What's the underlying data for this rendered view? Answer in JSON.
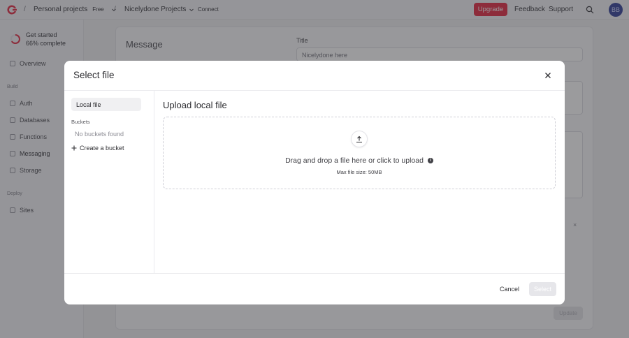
{
  "topbar": {
    "breadcrumb_sep": "/",
    "org": "Personal projects",
    "org_plan": "Free",
    "project": "Nicelydone Projects",
    "connect": "Connect",
    "upgrade": "Upgrade",
    "feedback": "Feedback",
    "support": "Support",
    "avatar_initials": "BB",
    "upgrade_color": "#e5364d"
  },
  "sidebar": {
    "progress_title": "Get started",
    "progress_sub": "66% complete",
    "progress_value": 0.66,
    "overview": "Overview",
    "build_label": "Build",
    "build_items": [
      "Auth",
      "Databases",
      "Functions",
      "Messaging",
      "Storage"
    ],
    "deploy_label": "Deploy",
    "deploy_items": [
      "Sites"
    ]
  },
  "background": {
    "message_heading": "Message",
    "title_label": "Title",
    "title_value": "Nicelydone here",
    "remove_icon": "×",
    "update_button": "Update"
  },
  "modal": {
    "title": "Select file",
    "close_icon": "close-icon",
    "local_file": "Local file",
    "buckets_label": "Buckets",
    "no_buckets": "No buckets found",
    "create_bucket": "Create a bucket",
    "upload_title": "Upload local file",
    "drag_text": "Drag and drop a file here or click to upload",
    "max_size": "Max file size: 50MB",
    "cancel": "Cancel",
    "select": "Select"
  }
}
